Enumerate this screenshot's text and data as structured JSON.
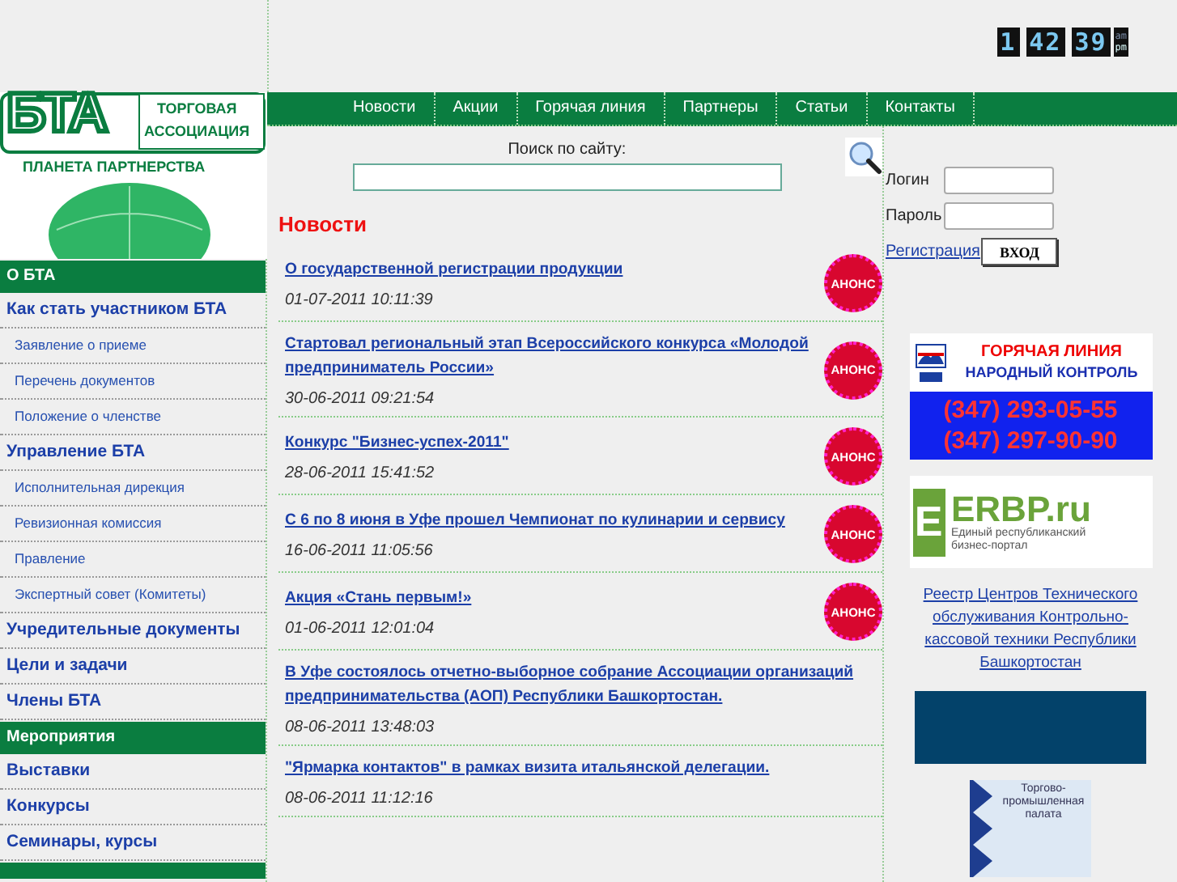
{
  "clock": {
    "hours": "1",
    "minutes": "42",
    "seconds": "39",
    "markers": [
      {
        "label": "am",
        "selected": false
      },
      {
        "label": "pm",
        "selected": true
      }
    ]
  },
  "logo": {
    "mark": "БТА",
    "line1": "ТОРГОВАЯ",
    "line2": "АССОЦИАЦИЯ",
    "slogan": "ПЛАНЕТА ПАРТНЕРСТВА"
  },
  "nav": [
    "Новости",
    "Акции",
    "Горячая линия",
    "Партнеры",
    "Статьи",
    "Контакты"
  ],
  "sidebar": [
    {
      "kind": "section",
      "label": "О БТА"
    },
    {
      "kind": "item",
      "label": "Как стать участником БТА"
    },
    {
      "kind": "subitem",
      "label": "Заявление о приеме"
    },
    {
      "kind": "subitem",
      "label": "Перечень документов"
    },
    {
      "kind": "subitem",
      "label": "Положение о членстве"
    },
    {
      "kind": "item",
      "label": "Управление БТА"
    },
    {
      "kind": "subitem",
      "label": "Исполнительная дирекция"
    },
    {
      "kind": "subitem",
      "label": "Ревизионная комиссия"
    },
    {
      "kind": "subitem",
      "label": "Правление"
    },
    {
      "kind": "subitem",
      "label": "Экспертный совет (Комитеты)"
    },
    {
      "kind": "item",
      "label": "Учредительные документы"
    },
    {
      "kind": "item",
      "label": "Цели и задачи"
    },
    {
      "kind": "item",
      "label": "Члены БТА"
    },
    {
      "kind": "section",
      "label": "Мероприятия"
    },
    {
      "kind": "item",
      "label": "Выставки"
    },
    {
      "kind": "item",
      "label": "Конкурсы"
    },
    {
      "kind": "item",
      "label": "Семинары, курсы"
    }
  ],
  "search": {
    "label": "Поиск по сайту:"
  },
  "news": {
    "heading": "Новости",
    "items": [
      {
        "title": "О государственной регистрации продукции",
        "date": "01-07-2011 10:11:39",
        "badge": "АНОНС"
      },
      {
        "title": "Стартовал региональный этап Всероссийского конкурса «Молодой предприниматель России»",
        "date": "30-06-2011 09:21:54",
        "badge": "АНОНС"
      },
      {
        "title": "Конкурс \"Бизнес-успех-2011\"",
        "date": "28-06-2011 15:41:52",
        "badge": "АНОНС"
      },
      {
        "title": "С 6 по 8 июня в Уфе прошел Чемпионат по кулинарии и сервису",
        "date": "16-06-2011 11:05:56",
        "badge": "АНОНС"
      },
      {
        "title": "Акция «Стань первым!»",
        "date": "01-06-2011 12:01:04",
        "badge": "АНОНС"
      },
      {
        "title": "В Уфе состоялось отчетно-выборное собрание Ассоциации организаций предпринимательства (АОП) Республики Башкортостан.",
        "date": "08-06-2011 13:48:03"
      },
      {
        "title": "\"Ярмарка контактов\" в рамках визита итальянской делегации.",
        "date": "08-06-2011 11:12:16"
      }
    ]
  },
  "login": {
    "login_label": "Логин",
    "password_label": "Пароль",
    "register": "Регистрация",
    "submit": "ВХОД"
  },
  "hotline": {
    "title": "ГОРЯЧАЯ ЛИНИЯ",
    "subtitle": "НАРОДНЫЙ КОНТРОЛЬ",
    "phones": [
      "(347) 293-05-55",
      "(347) 297-90-90"
    ]
  },
  "erbp": {
    "letter": "E",
    "name": "ERBP.ru",
    "tagline": "Единый республиканский бизнес-портал"
  },
  "registry_link": "Реестр Центров Технического обслуживания Контрольно-кассовой техники Республики Башкортостан",
  "chamber": {
    "text": "Торгово-промышленная палата"
  }
}
